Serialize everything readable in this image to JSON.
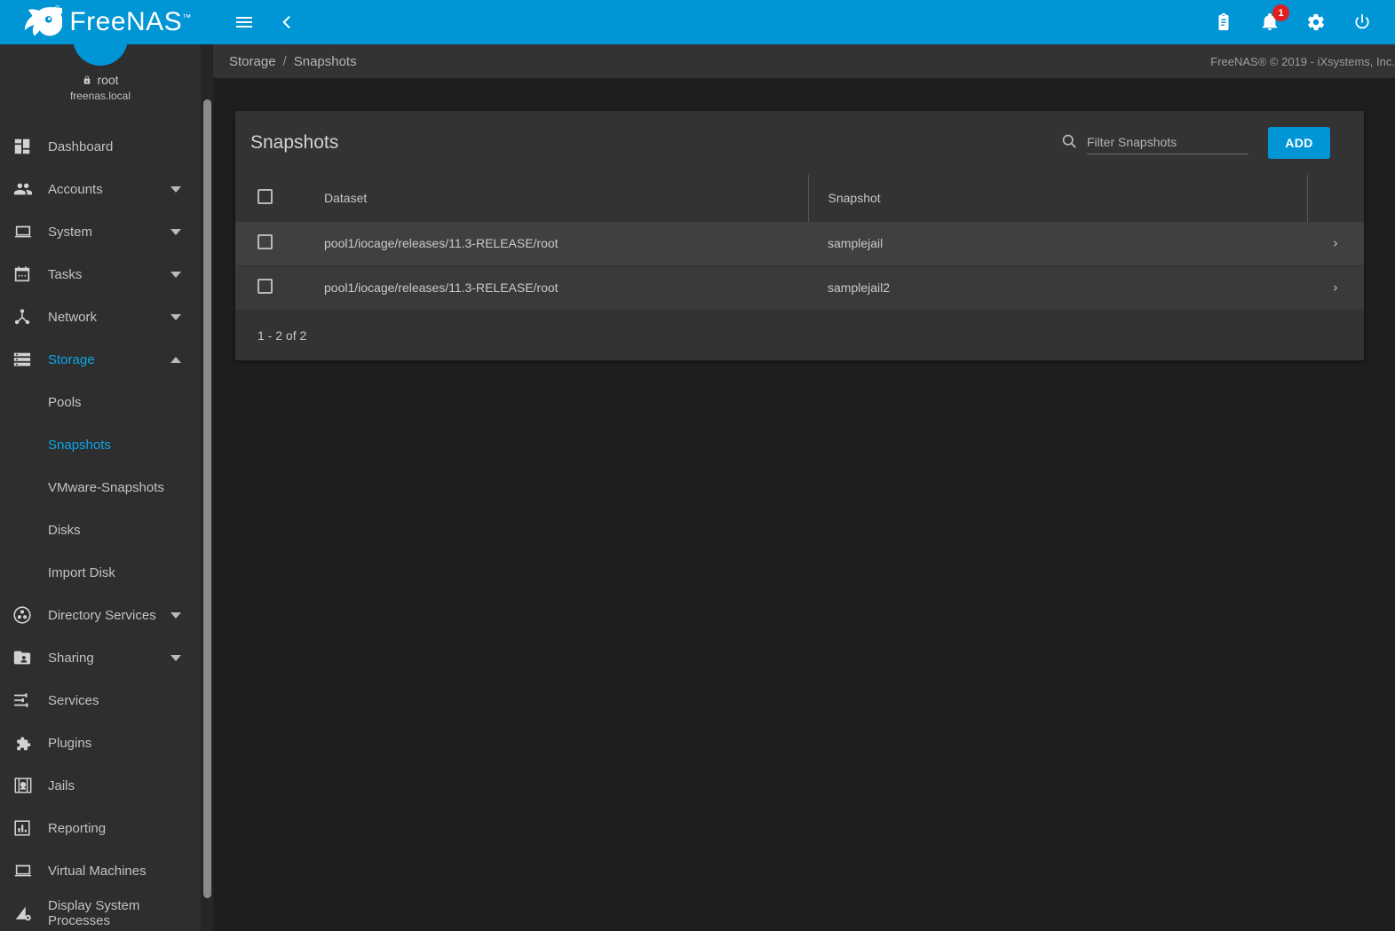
{
  "brand": {
    "name": "FreeNAS",
    "trademark": "™"
  },
  "topbar": {
    "menu_icon": "hamburger-menu-icon",
    "back_icon": "chevron-left-icon",
    "icons": [
      {
        "name": "clipboard-icon",
        "label": "Tasks"
      },
      {
        "name": "bell-icon",
        "label": "Alerts",
        "badge": "1"
      },
      {
        "name": "gear-icon",
        "label": "Settings"
      },
      {
        "name": "power-icon",
        "label": "Power"
      }
    ]
  },
  "sidebar": {
    "user": {
      "name": "root",
      "host": "freenas.local",
      "lock_icon": "lock-icon"
    },
    "items": [
      {
        "label": "Dashboard",
        "icon": "dashboard-icon",
        "expandable": false,
        "active": false
      },
      {
        "label": "Accounts",
        "icon": "accounts-icon",
        "expandable": true,
        "active": false
      },
      {
        "label": "System",
        "icon": "system-icon",
        "expandable": true,
        "active": false
      },
      {
        "label": "Tasks",
        "icon": "calendar-icon",
        "expandable": true,
        "active": false
      },
      {
        "label": "Network",
        "icon": "network-icon",
        "expandable": true,
        "active": false
      },
      {
        "label": "Storage",
        "icon": "storage-icon",
        "expandable": true,
        "active": true,
        "expanded": true
      },
      {
        "label": "Directory Services",
        "icon": "directory-services-icon",
        "expandable": true,
        "active": false
      },
      {
        "label": "Sharing",
        "icon": "sharing-icon",
        "expandable": true,
        "active": false
      },
      {
        "label": "Services",
        "icon": "services-sliders-icon",
        "expandable": false,
        "active": false
      },
      {
        "label": "Plugins",
        "icon": "puzzle-icon",
        "expandable": false,
        "active": false
      },
      {
        "label": "Jails",
        "icon": "jails-icon",
        "expandable": false,
        "active": false
      },
      {
        "label": "Reporting",
        "icon": "reporting-chart-icon",
        "expandable": false,
        "active": false
      },
      {
        "label": "Virtual Machines",
        "icon": "virtual-machines-icon",
        "expandable": false,
        "active": false
      },
      {
        "label": "Display System Processes",
        "icon": "display-processes-icon",
        "expandable": false,
        "active": false
      }
    ],
    "storage_children": [
      {
        "label": "Pools",
        "active": false
      },
      {
        "label": "Snapshots",
        "active": true
      },
      {
        "label": "VMware-Snapshots",
        "active": false
      },
      {
        "label": "Disks",
        "active": false
      },
      {
        "label": "Import Disk",
        "active": false
      }
    ]
  },
  "breadcrumb": {
    "items": [
      "Storage",
      "Snapshots"
    ],
    "separator": "/"
  },
  "copyright": "FreeNAS® © 2019 - iXsystems, Inc.",
  "card": {
    "title": "Snapshots",
    "search_placeholder": "Filter Snapshots",
    "search_value": "",
    "search_icon": "search-icon",
    "add_label": "ADD"
  },
  "table": {
    "columns": [
      "Dataset",
      "Snapshot"
    ],
    "rows": [
      {
        "dataset": "pool1/iocage/releases/11.3-RELEASE/root",
        "snapshot": "samplejail",
        "expand_icon": "chevron-right-icon",
        "hover": true
      },
      {
        "dataset": "pool1/iocage/releases/11.3-RELEASE/root",
        "snapshot": "samplejail2",
        "expand_icon": "chevron-right-icon",
        "hover": false
      }
    ],
    "pagination": "1 - 2 of 2"
  },
  "colors": {
    "accent": "#0095d5",
    "accent_text": "#0aa7e8",
    "sidebar_bg": "#2e2e2e",
    "card_bg": "#333333",
    "row_bg": "#3a3a3a",
    "page_bg": "#1e1e1e",
    "badge": "#e02020"
  }
}
